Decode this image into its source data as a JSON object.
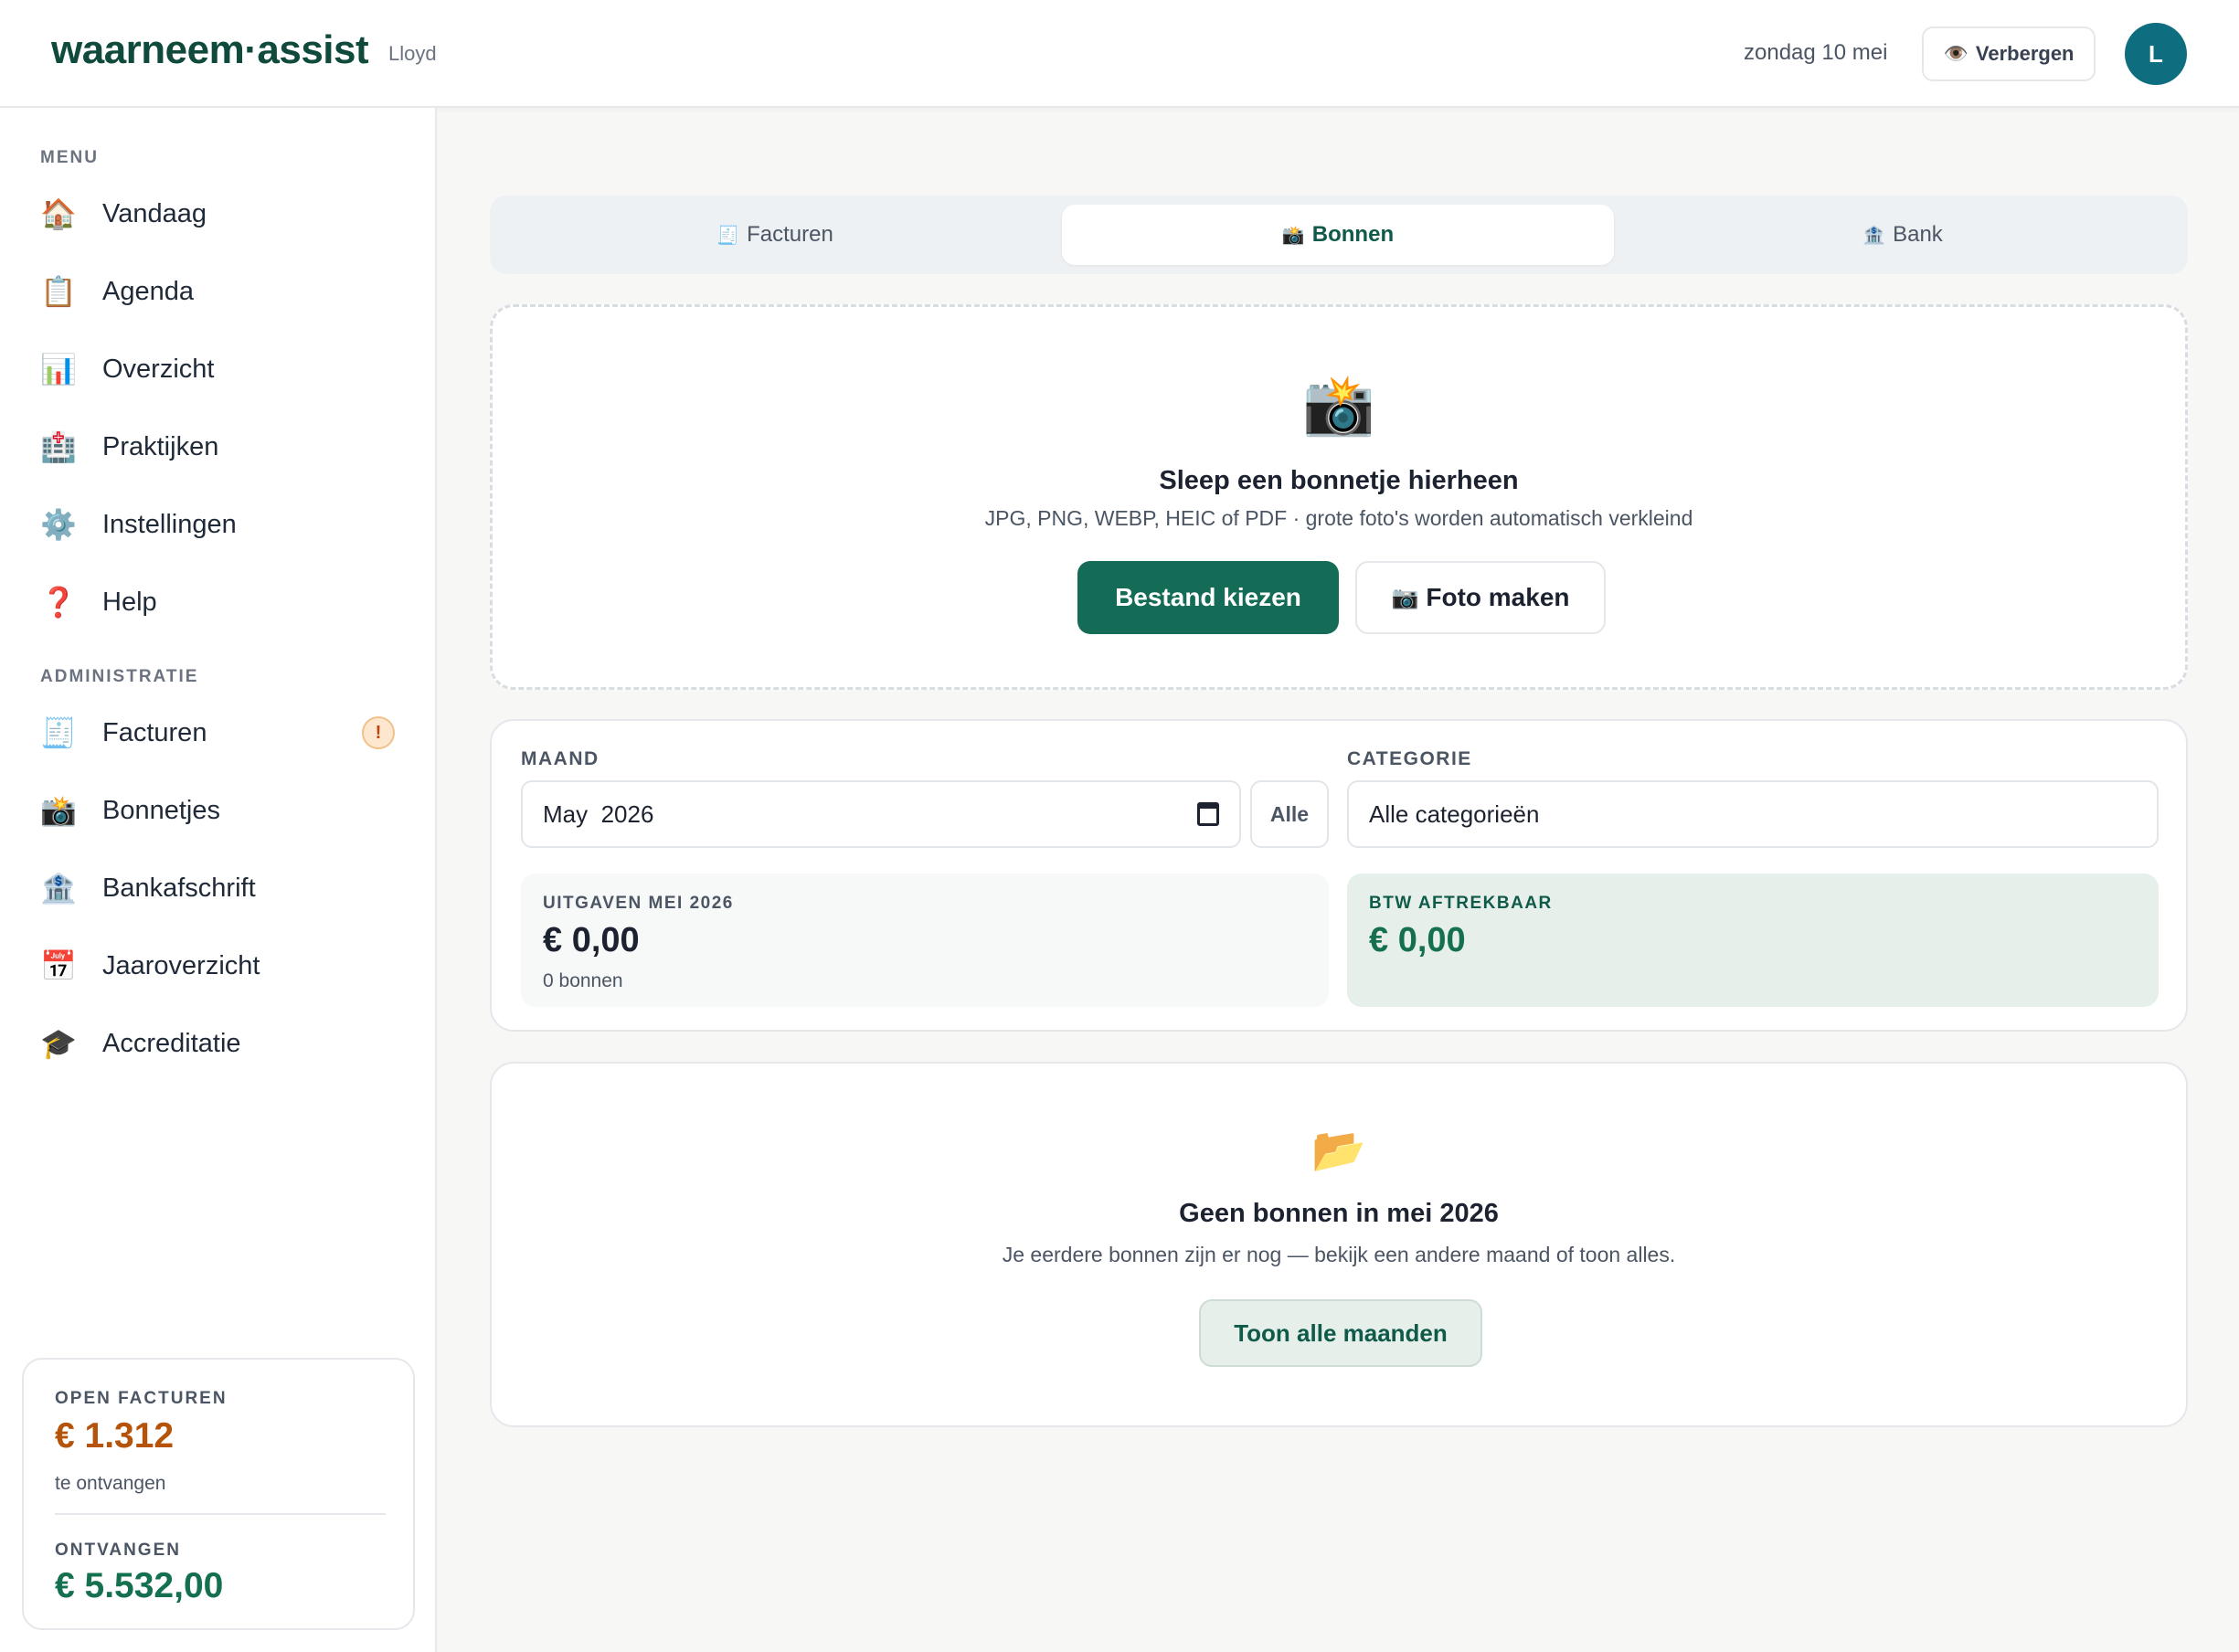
{
  "header": {
    "logo": "waarneem·assist",
    "user_name": "Lloyd",
    "date": "zondag 10 mei",
    "hide_label": "Verbergen",
    "hide_icon": "👁️",
    "avatar_initial": "L"
  },
  "sidebar": {
    "menu_label": "MENU",
    "admin_label": "ADMINISTRATIE",
    "menu_items": [
      {
        "icon": "🏠",
        "label": "Vandaag"
      },
      {
        "icon": "📋",
        "label": "Agenda"
      },
      {
        "icon": "📊",
        "label": "Overzicht"
      },
      {
        "icon": "🏥",
        "label": "Praktijken"
      },
      {
        "icon": "⚙️",
        "label": "Instellingen"
      },
      {
        "icon": "❓",
        "label": "Help"
      }
    ],
    "admin_items": [
      {
        "icon": "🧾",
        "label": "Facturen",
        "badge": "!"
      },
      {
        "icon": "📸",
        "label": "Bonnetjes"
      },
      {
        "icon": "🏦",
        "label": "Bankafschrift"
      },
      {
        "icon": "📅",
        "label": "Jaaroverzicht"
      },
      {
        "icon": "🎓",
        "label": "Accreditatie"
      }
    ],
    "summary": {
      "open_label": "OPEN FACTUREN",
      "open_amount": "€ 1.312",
      "open_sub": "te ontvangen",
      "received_label": "ONTVANGEN",
      "received_amount": "€ 5.532,00",
      "colors": {
        "open": "#b45309",
        "received": "#15704f"
      }
    }
  },
  "tabs": [
    {
      "icon": "🧾",
      "label": "Facturen"
    },
    {
      "icon": "📸",
      "label": "Bonnen"
    },
    {
      "icon": "🏦",
      "label": "Bank"
    }
  ],
  "dropzone": {
    "icon": "📸",
    "title": "Sleep een bonnetje hierheen",
    "subtitle": "JPG, PNG, WEBP, HEIC of PDF · grote foto's worden automatisch verkleind",
    "choose_label": "Bestand kiezen",
    "photo_icon": "📷",
    "photo_label": "Foto maken"
  },
  "filters": {
    "month_label": "MAAND",
    "month_value": "May  2026",
    "all_label": "Alle",
    "category_label": "CATEGORIE",
    "category_value": "Alle categorieën"
  },
  "stats": {
    "expenses_label": "UITGAVEN MEI 2026",
    "expenses_amount": "€ 0,00",
    "expenses_sub": "0 bonnen",
    "vat_label": "BTW AFTREKBAAR",
    "vat_amount": "€ 0,00"
  },
  "empty": {
    "icon": "📂",
    "title": "Geen bonnen in mei 2026",
    "subtitle": "Je eerdere bonnen zijn er nog — bekijk een andere maand of toon alles.",
    "button_label": "Toon alle maanden"
  },
  "colors": {
    "brand": "#146b56",
    "accent": "#0e6d7e"
  }
}
